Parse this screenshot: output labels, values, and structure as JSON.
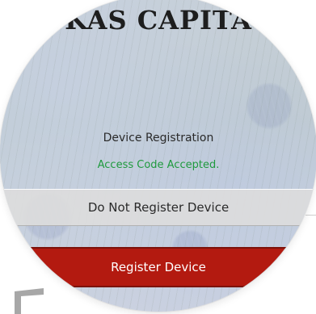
{
  "header": {
    "logo_text": "KAS CAPITA"
  },
  "registration": {
    "title": "Device Registration",
    "status_message": "Access Code Accepted.",
    "decline_button_label": "Do Not Register Device",
    "register_button_label": "Register Device"
  },
  "colors": {
    "status_success": "#1f9a3e",
    "primary_button": "#b31a10",
    "secondary_button": "#dcdcdc"
  }
}
